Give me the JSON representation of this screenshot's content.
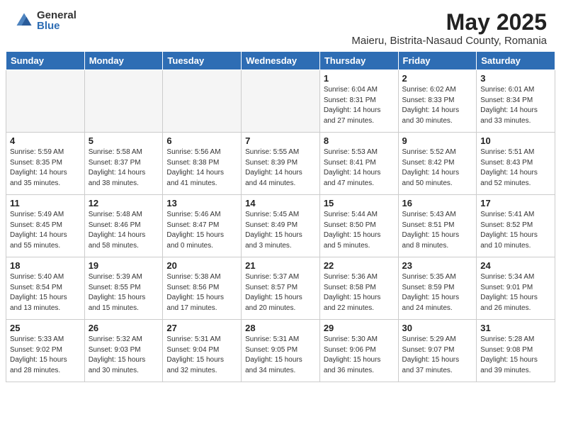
{
  "header": {
    "logo_general": "General",
    "logo_blue": "Blue",
    "month_title": "May 2025",
    "location": "Maieru, Bistrita-Nasaud County, Romania"
  },
  "weekdays": [
    "Sunday",
    "Monday",
    "Tuesday",
    "Wednesday",
    "Thursday",
    "Friday",
    "Saturday"
  ],
  "weeks": [
    [
      {
        "day": "",
        "info": ""
      },
      {
        "day": "",
        "info": ""
      },
      {
        "day": "",
        "info": ""
      },
      {
        "day": "",
        "info": ""
      },
      {
        "day": "1",
        "info": "Sunrise: 6:04 AM\nSunset: 8:31 PM\nDaylight: 14 hours\nand 27 minutes."
      },
      {
        "day": "2",
        "info": "Sunrise: 6:02 AM\nSunset: 8:33 PM\nDaylight: 14 hours\nand 30 minutes."
      },
      {
        "day": "3",
        "info": "Sunrise: 6:01 AM\nSunset: 8:34 PM\nDaylight: 14 hours\nand 33 minutes."
      }
    ],
    [
      {
        "day": "4",
        "info": "Sunrise: 5:59 AM\nSunset: 8:35 PM\nDaylight: 14 hours\nand 35 minutes."
      },
      {
        "day": "5",
        "info": "Sunrise: 5:58 AM\nSunset: 8:37 PM\nDaylight: 14 hours\nand 38 minutes."
      },
      {
        "day": "6",
        "info": "Sunrise: 5:56 AM\nSunset: 8:38 PM\nDaylight: 14 hours\nand 41 minutes."
      },
      {
        "day": "7",
        "info": "Sunrise: 5:55 AM\nSunset: 8:39 PM\nDaylight: 14 hours\nand 44 minutes."
      },
      {
        "day": "8",
        "info": "Sunrise: 5:53 AM\nSunset: 8:41 PM\nDaylight: 14 hours\nand 47 minutes."
      },
      {
        "day": "9",
        "info": "Sunrise: 5:52 AM\nSunset: 8:42 PM\nDaylight: 14 hours\nand 50 minutes."
      },
      {
        "day": "10",
        "info": "Sunrise: 5:51 AM\nSunset: 8:43 PM\nDaylight: 14 hours\nand 52 minutes."
      }
    ],
    [
      {
        "day": "11",
        "info": "Sunrise: 5:49 AM\nSunset: 8:45 PM\nDaylight: 14 hours\nand 55 minutes."
      },
      {
        "day": "12",
        "info": "Sunrise: 5:48 AM\nSunset: 8:46 PM\nDaylight: 14 hours\nand 58 minutes."
      },
      {
        "day": "13",
        "info": "Sunrise: 5:46 AM\nSunset: 8:47 PM\nDaylight: 15 hours\nand 0 minutes."
      },
      {
        "day": "14",
        "info": "Sunrise: 5:45 AM\nSunset: 8:49 PM\nDaylight: 15 hours\nand 3 minutes."
      },
      {
        "day": "15",
        "info": "Sunrise: 5:44 AM\nSunset: 8:50 PM\nDaylight: 15 hours\nand 5 minutes."
      },
      {
        "day": "16",
        "info": "Sunrise: 5:43 AM\nSunset: 8:51 PM\nDaylight: 15 hours\nand 8 minutes."
      },
      {
        "day": "17",
        "info": "Sunrise: 5:41 AM\nSunset: 8:52 PM\nDaylight: 15 hours\nand 10 minutes."
      }
    ],
    [
      {
        "day": "18",
        "info": "Sunrise: 5:40 AM\nSunset: 8:54 PM\nDaylight: 15 hours\nand 13 minutes."
      },
      {
        "day": "19",
        "info": "Sunrise: 5:39 AM\nSunset: 8:55 PM\nDaylight: 15 hours\nand 15 minutes."
      },
      {
        "day": "20",
        "info": "Sunrise: 5:38 AM\nSunset: 8:56 PM\nDaylight: 15 hours\nand 17 minutes."
      },
      {
        "day": "21",
        "info": "Sunrise: 5:37 AM\nSunset: 8:57 PM\nDaylight: 15 hours\nand 20 minutes."
      },
      {
        "day": "22",
        "info": "Sunrise: 5:36 AM\nSunset: 8:58 PM\nDaylight: 15 hours\nand 22 minutes."
      },
      {
        "day": "23",
        "info": "Sunrise: 5:35 AM\nSunset: 8:59 PM\nDaylight: 15 hours\nand 24 minutes."
      },
      {
        "day": "24",
        "info": "Sunrise: 5:34 AM\nSunset: 9:01 PM\nDaylight: 15 hours\nand 26 minutes."
      }
    ],
    [
      {
        "day": "25",
        "info": "Sunrise: 5:33 AM\nSunset: 9:02 PM\nDaylight: 15 hours\nand 28 minutes."
      },
      {
        "day": "26",
        "info": "Sunrise: 5:32 AM\nSunset: 9:03 PM\nDaylight: 15 hours\nand 30 minutes."
      },
      {
        "day": "27",
        "info": "Sunrise: 5:31 AM\nSunset: 9:04 PM\nDaylight: 15 hours\nand 32 minutes."
      },
      {
        "day": "28",
        "info": "Sunrise: 5:31 AM\nSunset: 9:05 PM\nDaylight: 15 hours\nand 34 minutes."
      },
      {
        "day": "29",
        "info": "Sunrise: 5:30 AM\nSunset: 9:06 PM\nDaylight: 15 hours\nand 36 minutes."
      },
      {
        "day": "30",
        "info": "Sunrise: 5:29 AM\nSunset: 9:07 PM\nDaylight: 15 hours\nand 37 minutes."
      },
      {
        "day": "31",
        "info": "Sunrise: 5:28 AM\nSunset: 9:08 PM\nDaylight: 15 hours\nand 39 minutes."
      }
    ]
  ]
}
